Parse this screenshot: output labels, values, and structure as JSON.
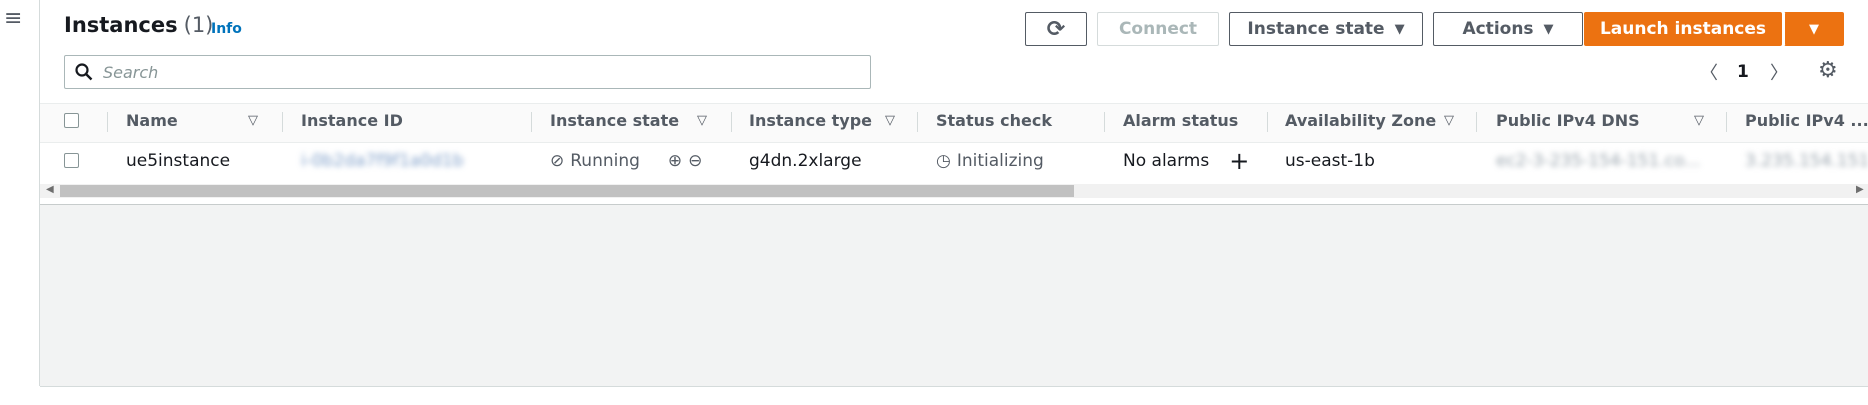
{
  "nav": {
    "menu_icon": "hamburger-icon",
    "menu_glyph": "≡"
  },
  "header": {
    "title": "Instances",
    "count": "(1)",
    "info_link": "Info"
  },
  "toolbar": {
    "refresh_icon": "refresh-icon",
    "refresh_glyph": "⟳",
    "connect_label": "Connect",
    "instance_state_label": "Instance state",
    "actions_label": "Actions",
    "launch_label": "Launch instances",
    "caret_glyph": "▼"
  },
  "search": {
    "placeholder": "Search",
    "icon": "search-icon",
    "icon_glyph": "🔍"
  },
  "pagination": {
    "prev_glyph": "〈",
    "current_page": "1",
    "next_glyph": "〉",
    "settings_icon": "gear-icon",
    "settings_glyph": "⚙"
  },
  "table": {
    "columns": [
      "Name",
      "Instance ID",
      "Instance state",
      "Instance type",
      "Status check",
      "Alarm status",
      "Availability Zone",
      "Public IPv4 DNS",
      "Public IPv4 ..."
    ],
    "sort_glyph": "▽",
    "rows": [
      {
        "name": "ue5instance",
        "instance_id": "i-0b2da7f9f1a0d1b",
        "state": "Running",
        "state_icon": "check-circle-icon",
        "state_glyph": "⊘",
        "zoom_in_glyph": "⊕",
        "zoom_out_glyph": "⊖",
        "instance_type": "g4dn.2xlarge",
        "status_check": "Initializing",
        "status_icon": "clock-icon",
        "status_glyph": "◷",
        "alarm_status": "No alarms",
        "add_alarm_glyph": "+",
        "availability_zone": "us-east-1b",
        "public_dns": "ec2-3-235-154-151.co...",
        "public_ip": "3.235.154.151"
      }
    ]
  },
  "scrollbar": {
    "left_arrow": "◀",
    "right_arrow": "▶"
  }
}
